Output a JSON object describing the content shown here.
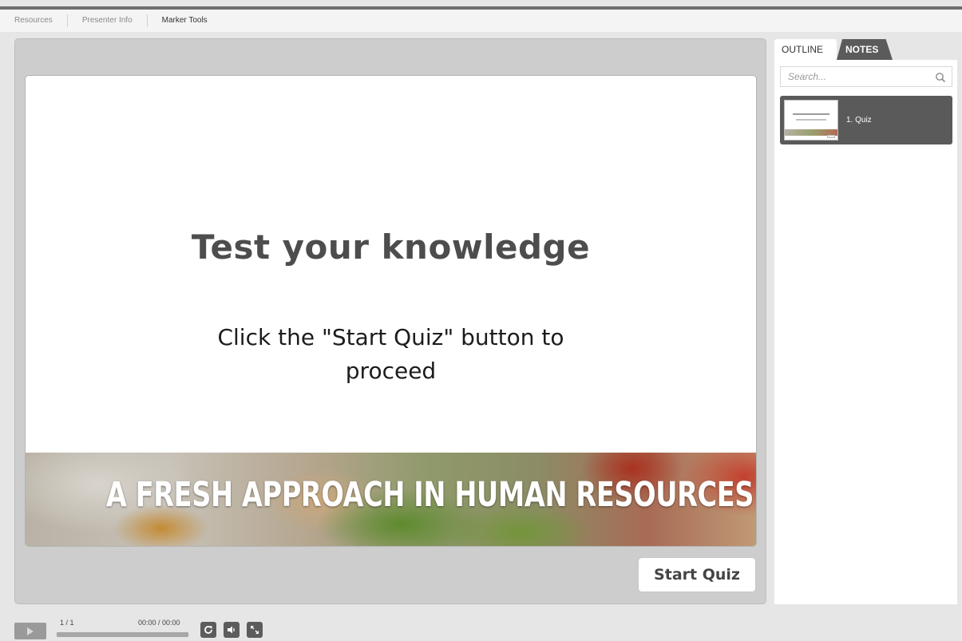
{
  "top_nav": {
    "items": [
      "Resources",
      "Presenter Info",
      "Marker Tools"
    ],
    "active_index": 2
  },
  "slide": {
    "title": "Test your knowledge",
    "subtitle": "Click the \"Start Quiz\" button to proceed",
    "banner_text": "A FRESH APPROACH IN HUMAN RESOURCES"
  },
  "start_button": {
    "label": "Start Quiz"
  },
  "sidebar": {
    "tabs": [
      {
        "label": "OUTLINE",
        "active": true
      },
      {
        "label": "NOTES",
        "active": false
      }
    ],
    "search": {
      "placeholder": "Search..."
    },
    "outline_items": [
      {
        "label": "1. Quiz",
        "selected": true
      }
    ]
  },
  "controls": {
    "slide_count": "1 / 1",
    "time": "00:00 / 00:00",
    "progress": 0,
    "icons": [
      "play-icon",
      "replay-icon",
      "volume-icon",
      "fullscreen-icon"
    ]
  },
  "colors": {
    "stage_bg": "#cdcdcd",
    "outline_item_bg": "#5a5a5a",
    "notes_tab_bg": "#5b5b5b",
    "control_button_bg": "#5c5c5c"
  }
}
